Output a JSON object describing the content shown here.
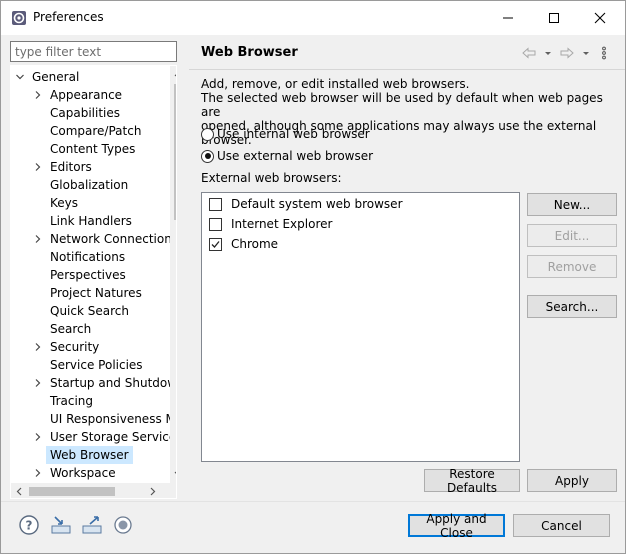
{
  "window": {
    "title": "Preferences",
    "controls": [
      "minimize-icon",
      "maximize-icon",
      "close-icon"
    ]
  },
  "filter": {
    "placeholder": "type filter text",
    "value": ""
  },
  "tree": {
    "items": [
      {
        "label": "General",
        "level": 0,
        "expander": "expanded"
      },
      {
        "label": "Appearance",
        "level": 1,
        "expander": "collapsed"
      },
      {
        "label": "Capabilities",
        "level": 1,
        "expander": "none"
      },
      {
        "label": "Compare/Patch",
        "level": 1,
        "expander": "none"
      },
      {
        "label": "Content Types",
        "level": 1,
        "expander": "none"
      },
      {
        "label": "Editors",
        "level": 1,
        "expander": "collapsed"
      },
      {
        "label": "Globalization",
        "level": 1,
        "expander": "none"
      },
      {
        "label": "Keys",
        "level": 1,
        "expander": "none"
      },
      {
        "label": "Link Handlers",
        "level": 1,
        "expander": "none"
      },
      {
        "label": "Network Connections",
        "level": 1,
        "expander": "collapsed"
      },
      {
        "label": "Notifications",
        "level": 1,
        "expander": "none"
      },
      {
        "label": "Perspectives",
        "level": 1,
        "expander": "none"
      },
      {
        "label": "Project Natures",
        "level": 1,
        "expander": "none"
      },
      {
        "label": "Quick Search",
        "level": 1,
        "expander": "none"
      },
      {
        "label": "Search",
        "level": 1,
        "expander": "none"
      },
      {
        "label": "Security",
        "level": 1,
        "expander": "collapsed"
      },
      {
        "label": "Service Policies",
        "level": 1,
        "expander": "none"
      },
      {
        "label": "Startup and Shutdown",
        "level": 1,
        "expander": "collapsed"
      },
      {
        "label": "Tracing",
        "level": 1,
        "expander": "none"
      },
      {
        "label": "UI Responsiveness Monitoring",
        "level": 1,
        "expander": "none"
      },
      {
        "label": "User Storage Service",
        "level": 1,
        "expander": "collapsed"
      },
      {
        "label": "Web Browser",
        "level": 1,
        "expander": "none",
        "selected": true
      },
      {
        "label": "Workspace",
        "level": 1,
        "expander": "collapsed"
      }
    ]
  },
  "page": {
    "title": "Web Browser",
    "nav_icons": [
      "back-arrow-icon",
      "back-dropdown-icon",
      "forward-arrow-icon",
      "forward-dropdown-icon",
      "view-menu-icon"
    ],
    "description_line1": "Add, remove, or edit installed web browsers.",
    "description_line2": "The selected web browser will be used by default when web pages are",
    "description_line3": "opened, although some applications may always use the external browser.",
    "radio_internal": {
      "label": "Use internal web browser",
      "checked": false
    },
    "radio_external": {
      "label": "Use external web browser",
      "checked": true
    },
    "browsers_label": "External web browsers:",
    "browsers": [
      {
        "label": "Default system web browser",
        "checked": false
      },
      {
        "label": "Internet Explorer",
        "checked": false
      },
      {
        "label": "Chrome",
        "checked": true
      }
    ],
    "buttons": {
      "new": "New...",
      "edit": "Edit...",
      "remove": "Remove",
      "search": "Search..."
    },
    "restore_defaults": "Restore Defaults",
    "apply": "Apply"
  },
  "footer": {
    "icons": [
      "help-icon",
      "import-icon",
      "export-icon",
      "record-icon"
    ],
    "apply_close": "Apply and Close",
    "cancel": "Cancel"
  },
  "colors": {
    "selection": "#cce8ff",
    "default_button_border": "#0078d7",
    "panel_bg": "#f0f0f0"
  }
}
